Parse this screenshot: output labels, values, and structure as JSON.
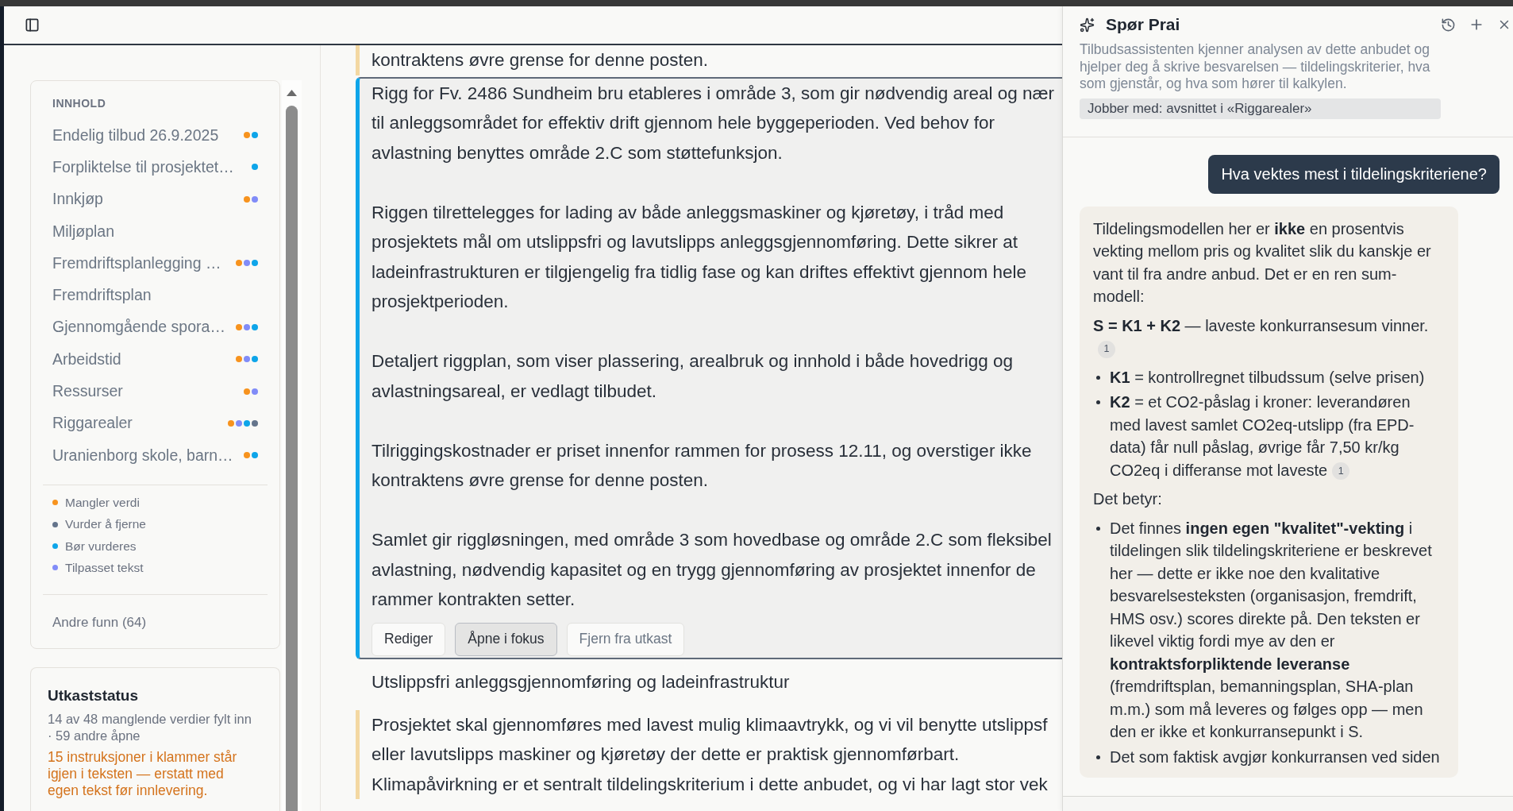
{
  "sidebar": {
    "contents": {
      "heading": "INNHOLD",
      "items": [
        {
          "label": "Endelig tilbud 26.9.2025",
          "markers": [
            {
              "color": "#f7931e"
            },
            {
              "color": "#0ea5e9"
            }
          ]
        },
        {
          "label": "Forpliktelse til prosjektet…",
          "markers": [
            {
              "color": "#0ea5e9"
            }
          ]
        },
        {
          "label": "Innkjøp",
          "markers": [
            {
              "color": "#f7931e"
            },
            {
              "color": "#818cf8"
            }
          ]
        },
        {
          "label": "Miljøplan"
        },
        {
          "label": "Fremdriftsplanlegging …",
          "markers": [
            {
              "color": "#f7931e"
            },
            {
              "color": "#818cf8"
            },
            {
              "color": "#0ea5e9"
            }
          ]
        },
        {
          "label": "Fremdriftsplan"
        },
        {
          "label": "Gjennomgående spora…",
          "markers": [
            {
              "color": "#f7931e"
            },
            {
              "color": "#818cf8"
            },
            {
              "color": "#0ea5e9"
            }
          ]
        },
        {
          "label": "Arbeidstid",
          "markers": [
            {
              "color": "#f7931e"
            },
            {
              "color": "#818cf8"
            },
            {
              "color": "#0ea5e9"
            }
          ]
        },
        {
          "label": "Ressurser",
          "markers": [
            {
              "color": "#f7931e"
            },
            {
              "color": "#818cf8"
            }
          ]
        },
        {
          "label": "Riggarealer",
          "markers": [
            {
              "color": "#f7931e"
            },
            {
              "color": "#818cf8"
            },
            {
              "color": "#0ea5e9"
            },
            {
              "color": "#64748b"
            }
          ]
        },
        {
          "label": "Uranienborg skole, barn…",
          "markers": [
            {
              "color": "#f7931e"
            },
            {
              "color": "#0ea5e9"
            }
          ]
        }
      ]
    },
    "legend": [
      {
        "label": "Mangler verdi",
        "color": "#f7931e"
      },
      {
        "label": "Vurder å fjerne",
        "color": "#64748b"
      },
      {
        "label": "Bør vurderes",
        "color": "#0ea5e9"
      },
      {
        "label": "Tilpasset tekst",
        "color": "#818cf8"
      }
    ],
    "other_findings": "Andre funn (64)"
  },
  "draft_status": {
    "title": "Utkaststatus",
    "summary": "14 av 48 manglende verdier fylt inn · 59 andre åpne",
    "warning": "15 instruksjoner i klammer står igjen i teksten — erstatt med egen tekst før innlevering."
  },
  "document": {
    "blocks": [
      {
        "kind": "text",
        "selected": false,
        "paragraphs": [
          "kontraktens øvre grense for denne posten."
        ]
      },
      {
        "kind": "text",
        "selected": true,
        "paragraphs": [
          "Rigg for Fv. 2486 Sundheim bru etableres i område 3, som gir nødvendig areal og nær\ntil anleggsområdet for effektiv drift gjennom hele byggeperioden. Ved behov for\navlastning benyttes område 2.C som støttefunksjon.",
          "Riggen tilrettelegges for lading av både anleggsmaskiner og kjøretøy, i tråd med\nprosjektets mål om utslippsfri og lavutslipps anleggsgjennomføring. Dette sikrer at\nladeinfrastrukturen er tilgjengelig fra tidlig fase og kan driftes effektivt gjennom hele\nprosjektperioden.",
          "Detaljert riggplan, som viser plassering, arealbruk og innhold i både hovedrigg og\navlastningsareal, er vedlagt tilbudet.",
          "Tilriggingskostnader er priset innenfor rammen for prosess 12.11, og overstiger ikke\nkontraktens øvre grense for denne posten.",
          "Samlet gir riggløsningen, med område 3 som hovedbase og område 2.C som fleksibel\navlastning, nødvendig kapasitet og en trygg gjennomføring av prosjektet innenfor de\nrammer kontrakten setter."
        ],
        "actions": [
          {
            "label": "Rediger",
            "kind": "plain"
          },
          {
            "label": "Åpne i fokus",
            "kind": "pressed"
          },
          {
            "label": "Fjern fra utkast",
            "kind": "muted"
          }
        ]
      },
      {
        "kind": "heading",
        "text": "Utslippsfri anleggsgjennomføring og ladeinfrastruktur"
      },
      {
        "kind": "text",
        "selected": false,
        "paragraphs": [
          "Prosjektet skal gjennomføres med lavest mulig klimaavtrykk, og vi vil benytte utslippsf\neller lavutslipps maskiner og kjøretøy der dette er praktisk gjennomførbart.\nKlimapåvirkning er et sentralt tildelingskriterium i dette anbudet, og vi har lagt stor vek"
        ]
      }
    ]
  },
  "assistant": {
    "title": "Spør Prai",
    "description": "Tilbudsassistenten kjenner analysen av dette anbudet og hjelper deg å skrive besvarelsen — tildelingskriterier, hva som gjenstår, og hva som hører til kalkylen.",
    "context": "Jobber med: avsnittet i «Riggarealer»",
    "messages": [
      {
        "kind": "user",
        "text": "Hva vektes mest i tildelingskriteriene?"
      },
      {
        "kind": "assistant",
        "blocks": [
          {
            "kind": "text",
            "text": "Tildelingsmodellen her er **ikke** en prosentvis vekting mellom pris og kvalitet slik du kanskje er vant til fra andre anbud. Det er en ren sum-modell:"
          },
          {
            "kind": "text",
            "text": "**S = K1 + K2** — laveste konkurransesum vinner.",
            "citation": "1"
          },
          {
            "kind": "list",
            "items": [
              {
                "text": "**K1** = kontrollregnet tilbudssum (selve prisen)"
              },
              {
                "text": "**K2** = et CO2-påslag i kroner: leverandøren med lavest samlet CO2eq-utslipp (fra EPD-data) får null påslag, øvrige får 7,50 kr/kg CO2eq i differanse mot laveste",
                "citation": "1"
              }
            ]
          },
          {
            "kind": "text",
            "text": "Det betyr:"
          },
          {
            "kind": "list",
            "items": [
              {
                "text": "Det finnes **ingen egen \"kvalitet\"-vekting** i tildelingen slik tildelingskriteriene er beskrevet her — dette er ikke noe den kvalitative besvarelsesteksten (organisasjon, fremdrift, HMS osv.) scores direkte på. Den teksten er likevel viktig fordi mye av den er **kontraktsforpliktende leveranse** (fremdriftsplan, bemanningsplan, SHA-plan m.m.) som må leveres og følges opp — men den er ikke et konkurransepunkt i S."
              },
              {
                "text": "Det som faktisk avgjør konkurransen ved siden"
              }
            ]
          }
        ]
      }
    ]
  }
}
